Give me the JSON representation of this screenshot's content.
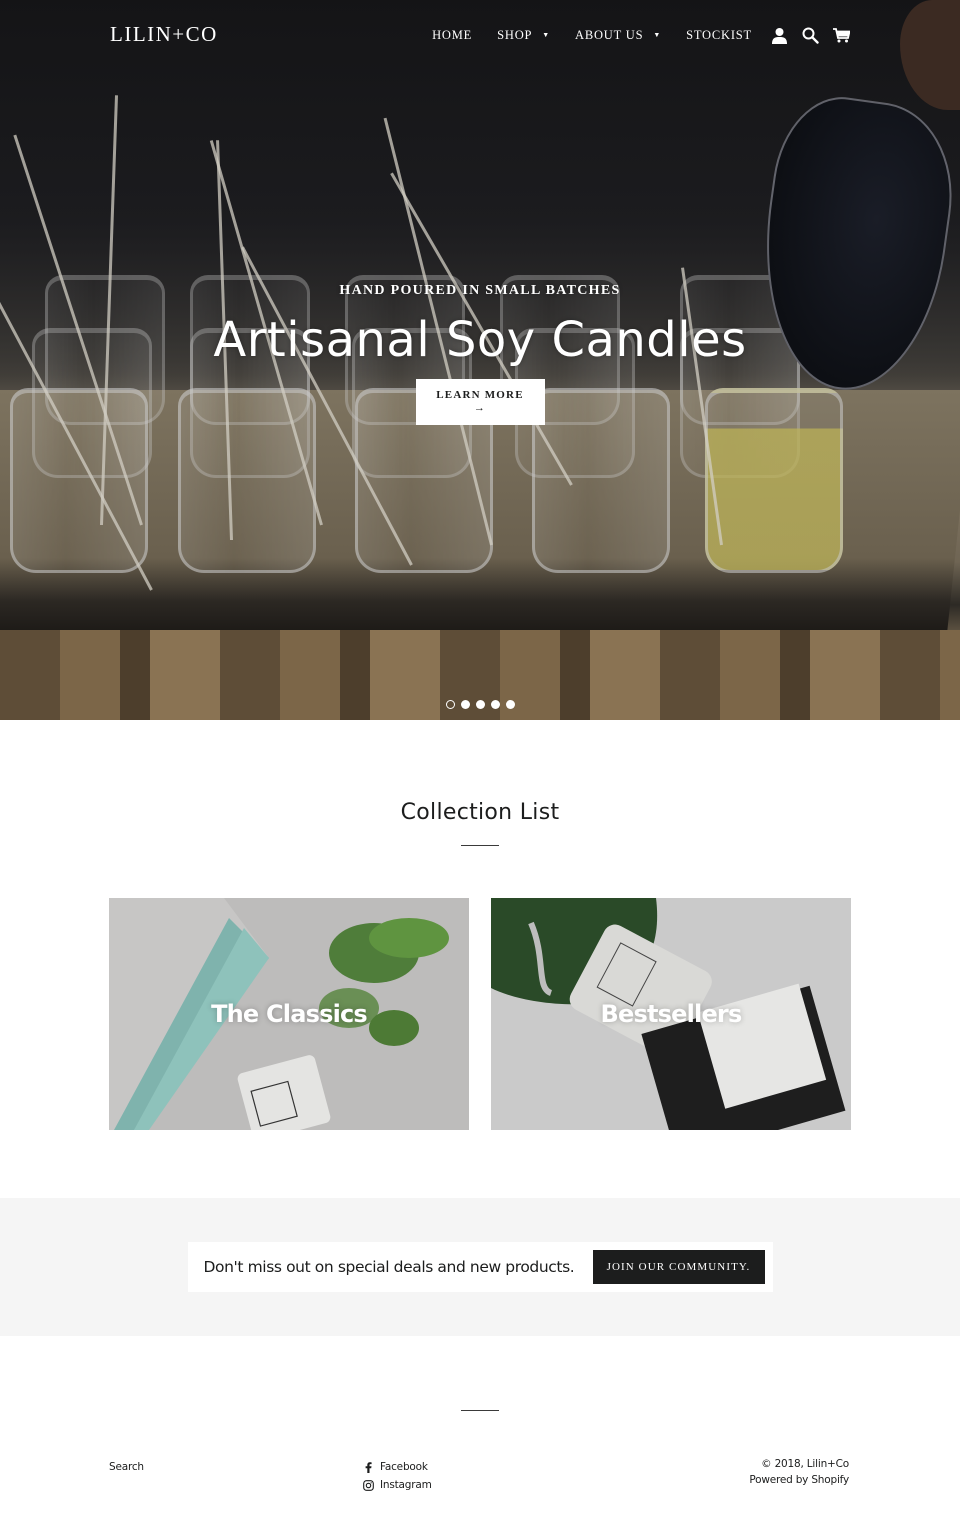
{
  "header": {
    "logo": "LILIN+CO",
    "nav": [
      {
        "label": "HOME",
        "has_dropdown": false
      },
      {
        "label": "SHOP",
        "has_dropdown": true
      },
      {
        "label": "ABOUT US",
        "has_dropdown": true
      },
      {
        "label": "STOCKIST",
        "has_dropdown": false
      }
    ],
    "icons": [
      "account-icon",
      "search-icon",
      "cart-icon"
    ],
    "dropdown_caret": "▼"
  },
  "hero": {
    "subheading": "HAND POURED IN SMALL BATCHES",
    "title": "Artisanal Soy Candles",
    "button_label": "LEARN MORE",
    "button_arrow": "→",
    "slides_total": 5,
    "active_slide": 1
  },
  "collection": {
    "title": "Collection List",
    "items": [
      {
        "label": "The Classics"
      },
      {
        "label": "Bestsellers"
      }
    ]
  },
  "newsletter": {
    "text": "Don't miss out on special deals and new products.",
    "button_label": "JOIN OUR COMMUNITY."
  },
  "footer": {
    "links": [
      {
        "label": "Search"
      }
    ],
    "social": [
      {
        "label": "Facebook",
        "icon": "facebook-icon"
      },
      {
        "label": "Instagram",
        "icon": "instagram-icon"
      }
    ],
    "copyright": "© 2018, Lilin+Co",
    "powered_by": "Powered by Shopify"
  },
  "colors": {
    "text": "#1c1d1d",
    "newsletter_bg": "#f5f5f5",
    "button_dark": "#1c1d1d",
    "white": "#ffffff"
  }
}
